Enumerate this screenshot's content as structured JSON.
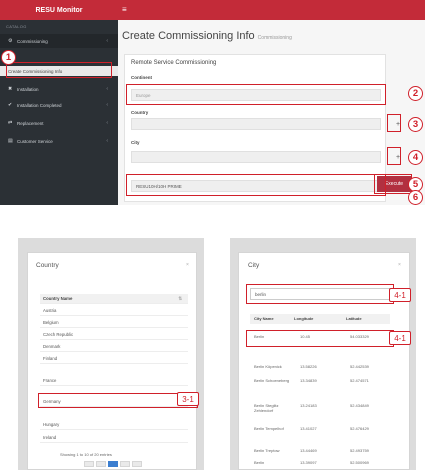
{
  "app": {
    "brand": "RESU Monitor",
    "hamburger": "≡"
  },
  "sidebar": {
    "category": "CATALOG",
    "items": [
      {
        "label": "Commissioning",
        "icon": "gear-icon",
        "glyph": "⚙"
      },
      {
        "label": "Create Commissioning Info",
        "icon": "",
        "glyph": ""
      },
      {
        "label": "Installation",
        "icon": "wrench-icon",
        "glyph": "✖"
      },
      {
        "label": "Installation Completed",
        "icon": "check-icon",
        "glyph": "✔"
      },
      {
        "label": "Replacement",
        "icon": "swap-icon",
        "glyph": "⇄"
      },
      {
        "label": "Customer Service",
        "icon": "document-icon",
        "glyph": "▤"
      }
    ]
  },
  "page": {
    "title": "Create Commissioning Info",
    "subtitle": "Commissioning"
  },
  "panel": {
    "title": "Remote Service Commissioning",
    "continent_label": "Continent",
    "continent_value": "Europe",
    "country_label": "Country",
    "city_label": "City",
    "serial_value": "RESU10H/10H PRIME",
    "execute_label": "Execute",
    "plus": "+"
  },
  "callouts": [
    "1",
    "2",
    "3",
    "4",
    "5",
    "6",
    "3-1",
    "4-1",
    "4-1"
  ],
  "country_modal": {
    "title": "Country",
    "close": "×",
    "column": "Country Name",
    "rows": [
      "Austria",
      "Belgium",
      "Czech Republic",
      "Denmark",
      "Finland",
      "France",
      "Germany",
      "Hungary",
      "Ireland"
    ],
    "selected": "Germany",
    "footer": "Showing 1 to 10 of 20 entries"
  },
  "city_modal": {
    "title": "City",
    "close": "×",
    "search_value": "berlin",
    "columns": [
      "City Name",
      "Longitude",
      "Latitude"
    ],
    "rows": [
      [
        "Berlin",
        "10.45",
        "54.033329"
      ],
      [
        "Berlin Köpenick",
        "13.58226",
        "52.442539"
      ],
      [
        "Berlin Schoeneberg",
        "13.34839",
        "52.474571"
      ],
      [
        "Berlin Steglitz Zehlendorf",
        "13.24183",
        "52.434849"
      ],
      [
        "Berlin Tempelhof",
        "13.41027",
        "52.476429"
      ],
      [
        "Berlin Treptow",
        "13.44469",
        "52.493759"
      ],
      [
        "Berlin",
        "13.39097",
        "52.500969"
      ]
    ]
  },
  "colors": {
    "brand": "#c32b39",
    "sidebar": "#2b3035",
    "callout": "#d0202a",
    "execute": "#b23040"
  }
}
